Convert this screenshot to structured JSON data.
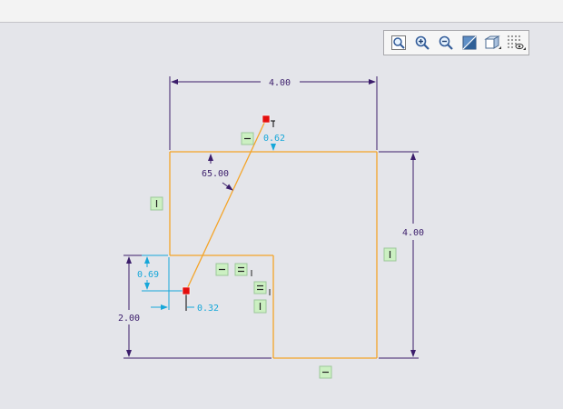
{
  "toolbar": {
    "buttons": [
      {
        "icon": "zoom-fit-icon"
      },
      {
        "icon": "zoom-in-icon"
      },
      {
        "icon": "zoom-out-icon"
      },
      {
        "icon": "shade-icon"
      },
      {
        "icon": "view-box-icon"
      },
      {
        "icon": "sketch-grid-icon"
      }
    ]
  },
  "dimensions": {
    "top_width": "4.00",
    "right_height": "4.00",
    "left_height": "2.00",
    "offset_top": "0.62",
    "angle": "65.00",
    "offset_left_vertical": "0.69",
    "offset_bottom": "0.32"
  },
  "colors": {
    "background": "#e4e5ea",
    "sketch_line": "#f4a428",
    "dimension_dark": "#3b1d6b",
    "dimension_cyan": "#16a7d9",
    "constraint_bg": "#ccf0c2",
    "endpoint": "#e30e0e"
  }
}
